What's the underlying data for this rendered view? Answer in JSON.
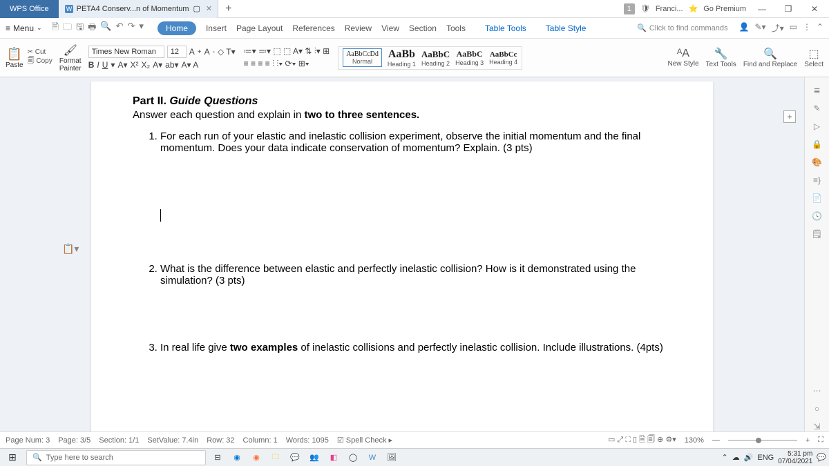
{
  "title_bar": {
    "app_name": "WPS Office",
    "doc_tab": "PETA4 Conserv...n of Momentum",
    "badge": "1",
    "user": "Franci...",
    "premium": "Go Premium"
  },
  "menu": {
    "menu_label": "Menu",
    "tabs": [
      "Home",
      "Insert",
      "Page Layout",
      "References",
      "Review",
      "View",
      "Section",
      "Tools"
    ],
    "table_tools": "Table Tools",
    "table_style": "Table Style",
    "search_placeholder": "Click to find commands"
  },
  "ribbon": {
    "paste": "Paste",
    "cut": "Cut",
    "copy": "Copy",
    "format_painter": "Format Painter",
    "font_name": "Times New Roman",
    "font_size": "12",
    "styles": [
      {
        "preview": "AaBbCcDd",
        "label": "Normal"
      },
      {
        "preview": "AaBb",
        "label": "Heading 1"
      },
      {
        "preview": "AaBbC",
        "label": "Heading 2"
      },
      {
        "preview": "AaBbC",
        "label": "Heading 3"
      },
      {
        "preview": "AaBbCc",
        "label": "Heading 4"
      }
    ],
    "new_style": "New Style",
    "text_tools": "Text Tools",
    "find_replace": "Find and Replace",
    "select": "Select"
  },
  "document": {
    "part": "Part II.",
    "part_title": "Guide Questions",
    "instruction": "Answer each question and explain in two to three sentences.",
    "q1": "For each run of your elastic and inelastic collision experiment, observe the initial momentum and the final momentum. Does your data indicate conservation of momentum? Explain. (3 pts)",
    "q2": "What is the difference between elastic and perfectly inelastic collision? How is it demonstrated using the simulation?  (3 pts)",
    "q3": "In real life give two examples of inelastic collisions and perfectly inelastic collision. Include illustrations. (4pts)"
  },
  "status": {
    "page_num": "Page Num: 3",
    "page": "Page: 3/5",
    "section": "Section: 1/1",
    "setvalue": "SetValue: 7.4in",
    "row": "Row: 32",
    "column": "Column: 1",
    "words": "Words: 1095",
    "spell": "Spell Check",
    "zoom": "130%"
  },
  "taskbar": {
    "search": "Type here to search",
    "lang": "ENG",
    "time": "5:31 pm",
    "date": "07/04/2021"
  }
}
